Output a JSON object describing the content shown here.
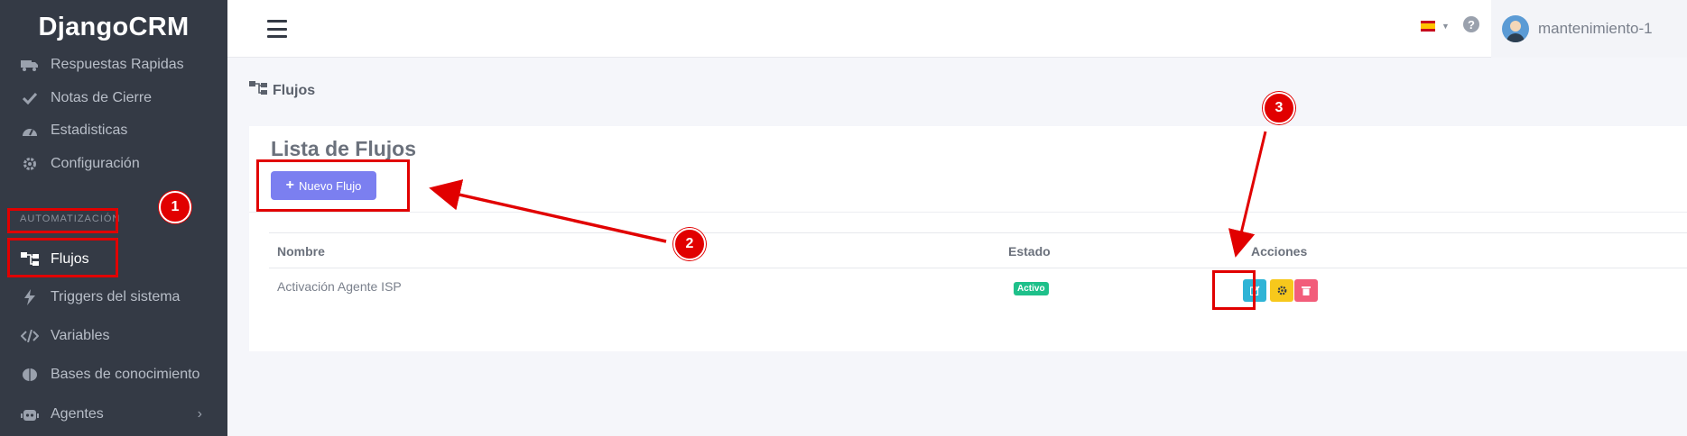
{
  "app": {
    "brand": "DjangoCRM"
  },
  "sidebar": {
    "items": [
      {
        "label": "Respuestas Rapidas",
        "icon": "truck-icon"
      },
      {
        "label": "Notas de Cierre",
        "icon": "check-icon"
      },
      {
        "label": "Estadisticas",
        "icon": "gauge-icon"
      },
      {
        "label": "Configuración",
        "icon": "gear-icon"
      },
      {
        "label": "Flujos",
        "icon": "sitemap-icon",
        "active": true
      },
      {
        "label": "Triggers del sistema",
        "icon": "bolt-icon"
      },
      {
        "label": "Variables",
        "icon": "code-icon"
      },
      {
        "label": "Bases de conocimiento",
        "icon": "brain-icon"
      },
      {
        "label": "Agentes",
        "icon": "robot-icon"
      }
    ],
    "section_header": "AUTOMATIZACIÓN"
  },
  "topbar": {
    "user_name": "mantenimiento-1",
    "language": "es"
  },
  "breadcrumb": {
    "label": "Flujos"
  },
  "card": {
    "title": "Lista de Flujos",
    "new_button_label": "Nuevo Flujo"
  },
  "table": {
    "headers": [
      "Nombre",
      "Estado",
      "Acciones"
    ],
    "rows": [
      {
        "nombre": "Activación Agente ISP",
        "estado": "Activo"
      }
    ]
  },
  "annotations": {
    "markers": [
      "1",
      "2",
      "3"
    ],
    "color": "#e10000"
  },
  "colors": {
    "sidebar_bg": "#343a45",
    "primary": "#7b7ff0",
    "success": "#1ec08a",
    "info": "#2fb4d6",
    "warning": "#f7c81c",
    "danger": "#f25d7a"
  }
}
